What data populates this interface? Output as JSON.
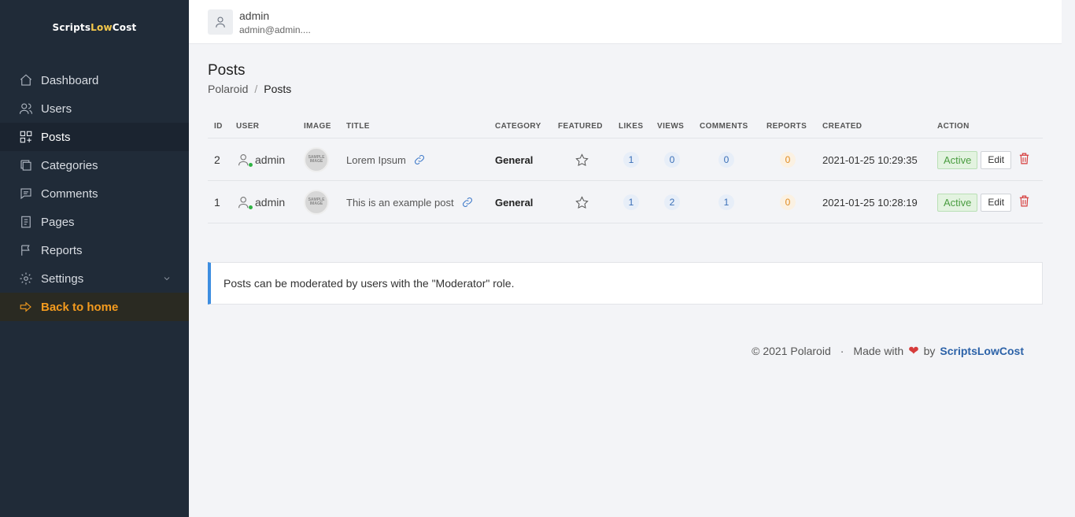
{
  "brand": {
    "part1": "Scripts",
    "part2": "Low",
    "part3": "Cost"
  },
  "sidebar": {
    "items": [
      {
        "label": "Dashboard",
        "icon": "home-icon"
      },
      {
        "label": "Users",
        "icon": "users-icon"
      },
      {
        "label": "Posts",
        "icon": "grid-icon",
        "active": true
      },
      {
        "label": "Categories",
        "icon": "folders-icon"
      },
      {
        "label": "Comments",
        "icon": "message-icon"
      },
      {
        "label": "Pages",
        "icon": "document-icon"
      },
      {
        "label": "Reports",
        "icon": "flag-icon"
      },
      {
        "label": "Settings",
        "icon": "gear-icon"
      }
    ],
    "back_home": "Back to home"
  },
  "topbar": {
    "user_name": "admin",
    "user_email": "admin@admin...."
  },
  "page": {
    "title": "Posts",
    "breadcrumb": {
      "root": "Polaroid",
      "separator": "/",
      "current": "Posts"
    }
  },
  "table": {
    "headers": {
      "id": "ID",
      "user": "USER",
      "image": "IMAGE",
      "title": "TITLE",
      "category": "CATEGORY",
      "featured": "FEATURED",
      "likes": "LIKES",
      "views": "VIEWS",
      "comments": "COMMENTS",
      "reports": "REPORTS",
      "created": "CREATED",
      "action": "ACTION"
    },
    "rows": [
      {
        "id": "2",
        "user": "admin",
        "image": "SAMPLE IMAGE",
        "title": "Lorem Ipsum",
        "category": "General",
        "likes": "1",
        "views": "0",
        "comments": "0",
        "reports": "0",
        "created": "2021-01-25 10:29:35",
        "status": "Active",
        "edit": "Edit"
      },
      {
        "id": "1",
        "user": "admin",
        "image": "SAMPLE IMAGE",
        "title": "This is an example post",
        "category": "General",
        "likes": "1",
        "views": "2",
        "comments": "1",
        "reports": "0",
        "created": "2021-01-25 10:28:19",
        "status": "Active",
        "edit": "Edit"
      }
    ]
  },
  "notice": "Posts can be moderated by users with the \"Moderator\" role.",
  "footer": {
    "copyright": "© 2021 Polaroid",
    "dot": "·",
    "made_with": "Made with",
    "by": "by",
    "credit": "ScriptsLowCost"
  },
  "colors": {
    "sidebar": "#202b38",
    "accent": "#f49b1e",
    "link": "#3a77c8",
    "danger": "#d63b3b",
    "success": "#4a9c40"
  }
}
